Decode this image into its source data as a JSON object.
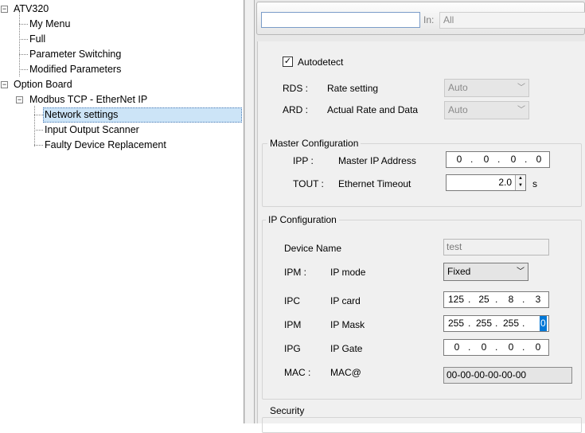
{
  "tree": {
    "items": [
      {
        "label": "ATV320",
        "level": 0,
        "expander": "minus"
      },
      {
        "label": "My Menu",
        "level": 1
      },
      {
        "label": "Full",
        "level": 1
      },
      {
        "label": "Parameter Switching",
        "level": 1
      },
      {
        "label": "Modified Parameters",
        "level": 1
      },
      {
        "label": "Option Board",
        "level": 0,
        "expander": "minus"
      },
      {
        "label": "Modbus TCP - EtherNet IP",
        "level": 1,
        "expander": "minus"
      },
      {
        "label": "Network settings",
        "level": 2,
        "selected": true
      },
      {
        "label": "Input Output Scanner",
        "level": 2
      },
      {
        "label": "Faulty Device Replacement",
        "level": 2
      }
    ]
  },
  "search": {
    "value": "",
    "in_label": "In:",
    "scope": "All"
  },
  "autodetect": {
    "label": "Autodetect",
    "checked": true
  },
  "rate": {
    "rds_code": "RDS :",
    "rds_label": "Rate setting",
    "rds_value": "Auto",
    "ard_code": "ARD :",
    "ard_label": "Actual Rate and Data",
    "ard_value": "Auto"
  },
  "master": {
    "title": "Master Configuration",
    "ipp_code": "IPP :",
    "ipp_label": "Master IP Address",
    "ipp_octets": [
      "0",
      "0",
      "0",
      "0"
    ],
    "tout_code": "TOUT :",
    "tout_label": "Ethernet Timeout",
    "tout_value": "2.0",
    "tout_unit": "s"
  },
  "ipconfig": {
    "title": "IP Configuration",
    "device_name_label": "Device Name",
    "device_name_value": "test",
    "ipm_code": "IPM :",
    "ipm_label": "IP mode",
    "ipm_value": "Fixed",
    "ipc_code": "IPC",
    "ipc_label": "IP card",
    "ipc_octets": [
      "125",
      "25",
      "8",
      "3"
    ],
    "mask_code": "IPM",
    "mask_label": "IP Mask",
    "mask_octets": [
      "255",
      "255",
      "255",
      "0"
    ],
    "ipg_code": "IPG",
    "ipg_label": "IP Gate",
    "ipg_octets": [
      "0",
      "0",
      "0",
      "0"
    ],
    "mac_code": "MAC :",
    "mac_label": "MAC@",
    "mac_value": "00-00-00-00-00-00"
  },
  "security": {
    "title": "Security"
  },
  "colors": {
    "selection": "#cce4f7",
    "panel": "#f0f0f0",
    "accent": "#0078d7"
  }
}
